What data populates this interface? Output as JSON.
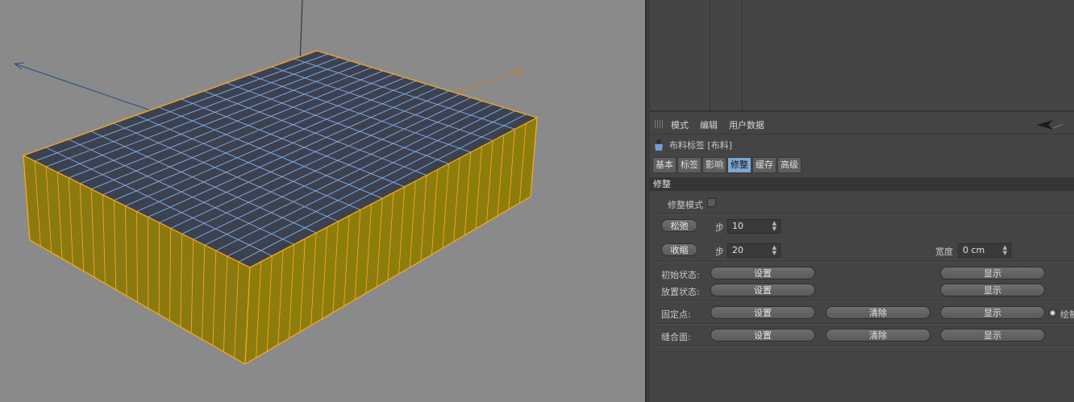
{
  "menu": {
    "mode": "模式",
    "edit": "编辑",
    "user_data": "用户数据"
  },
  "tag": {
    "title": "布料标签 [布料]"
  },
  "tabs": [
    {
      "label": "基本",
      "active": false
    },
    {
      "label": "标签",
      "active": false
    },
    {
      "label": "影响",
      "active": false
    },
    {
      "label": "修整",
      "active": true
    },
    {
      "label": "缓存",
      "active": false
    },
    {
      "label": "高级",
      "active": false
    }
  ],
  "section": {
    "title": "修整"
  },
  "dress_mode": {
    "label": "修整模式",
    "checked": false
  },
  "relax": {
    "button": "松弛",
    "steps_label": "步",
    "steps_value": "10"
  },
  "shrink": {
    "button": "收缩",
    "steps_label": "步",
    "steps_value": "20",
    "width_label": "宽度",
    "width_value": "0 cm"
  },
  "init_state": {
    "label": "初始状态:",
    "set": "设置",
    "show": "显示"
  },
  "dressed_state": {
    "label": "放置状态:",
    "set": "设置",
    "show": "显示"
  },
  "fix_points": {
    "label": "固定点:",
    "set": "设置",
    "clear": "清除",
    "show": "显示",
    "radio_label": "绘制"
  },
  "seam_polys": {
    "label": "缝合面:",
    "set": "设置",
    "clear": "清除",
    "show": "显示"
  },
  "colors": {
    "accent_tab": "#7ea7d2",
    "viewport_bg": "#8a8a8a",
    "mesh_edge": "#f5a623",
    "mesh_top": "#3c4150",
    "mesh_grid": "#7fb0e8",
    "mesh_side": "#8a7a10"
  }
}
